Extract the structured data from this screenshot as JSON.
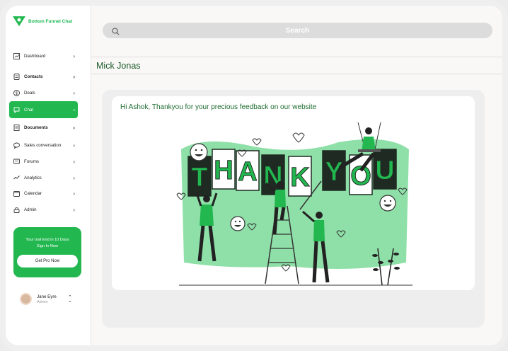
{
  "brand": {
    "name": "Bottom Funnel Chat"
  },
  "sidebar": {
    "items": [
      {
        "label": "Dashboard",
        "icon": "dashboard-icon"
      },
      {
        "label": "Contacts",
        "icon": "contacts-icon"
      },
      {
        "label": "Deals",
        "icon": "deals-icon"
      },
      {
        "label": "Chat",
        "icon": "chat-icon"
      },
      {
        "label": "Documents",
        "icon": "documents-icon"
      },
      {
        "label": "Sales conversation",
        "icon": "sales-conversation-icon"
      },
      {
        "label": "Forums",
        "icon": "forums-icon"
      },
      {
        "label": "Analytics",
        "icon": "analytics-icon"
      },
      {
        "label": "Calendar",
        "icon": "calendar-icon"
      },
      {
        "label": "Admin",
        "icon": "admin-icon"
      }
    ]
  },
  "promo": {
    "line1": "Your trail End in 10 Days",
    "line2": "Sign In Now",
    "button": "Get Pro Now"
  },
  "user": {
    "name": "Jane Eyre",
    "role": "Admin"
  },
  "search": {
    "placeholder": "Search"
  },
  "conversation": {
    "contact_name": "Mick Jonas",
    "message": "Hi Ashok, Thankyou for your precious feedback on our website",
    "illustration_letters": [
      "T",
      "H",
      "A",
      "N",
      "K",
      "Y",
      "O",
      "U"
    ]
  },
  "colors": {
    "accent": "#22b84f",
    "dark_green": "#1c5a2a",
    "light_green": "#8fe0a8"
  }
}
